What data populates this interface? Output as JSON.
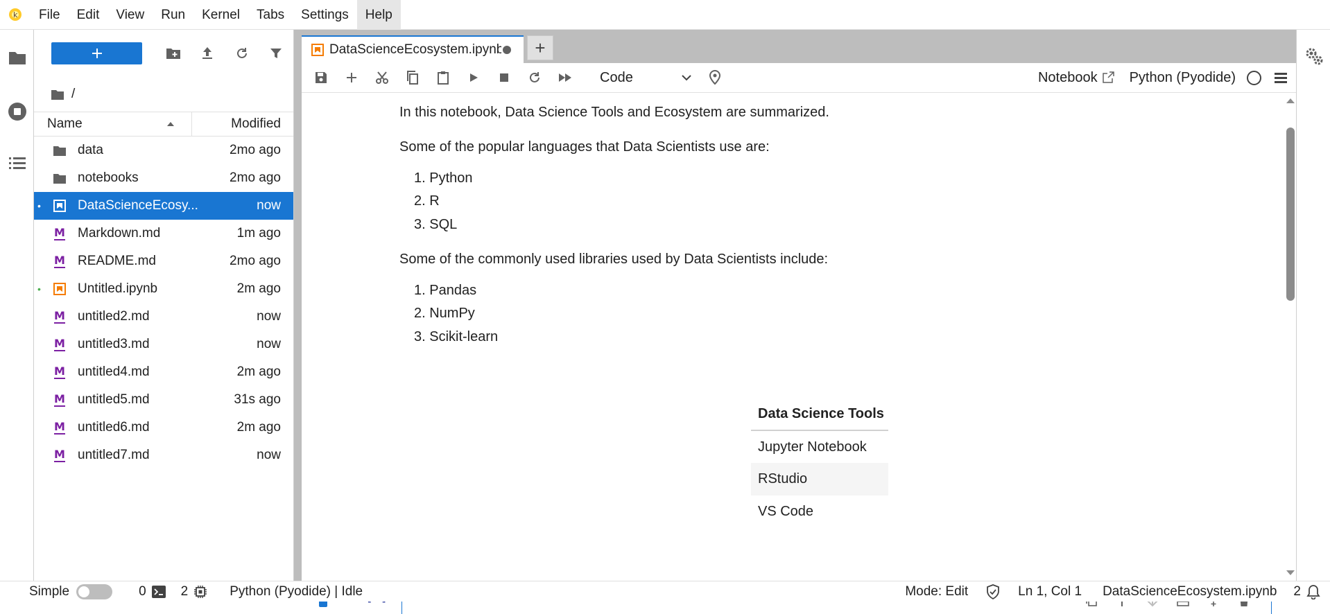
{
  "menu": {
    "items": [
      "File",
      "Edit",
      "View",
      "Run",
      "Kernel",
      "Tabs",
      "Settings",
      "Help"
    ],
    "active": "Help"
  },
  "filebrowser": {
    "breadcrumb": "/",
    "columns": {
      "name": "Name",
      "modified": "Modified"
    },
    "items": [
      {
        "name": "data",
        "modified": "2mo ago",
        "type": "folder",
        "dot": ""
      },
      {
        "name": "notebooks",
        "modified": "2mo ago",
        "type": "folder",
        "dot": ""
      },
      {
        "name": "DataScienceEcosy...",
        "modified": "now",
        "type": "notebook",
        "dot": "•",
        "selected": true
      },
      {
        "name": "Markdown.md",
        "modified": "1m ago",
        "type": "markdown",
        "dot": ""
      },
      {
        "name": "README.md",
        "modified": "2mo ago",
        "type": "markdown",
        "dot": ""
      },
      {
        "name": "Untitled.ipynb",
        "modified": "2m ago",
        "type": "notebook-orange",
        "dot": "•"
      },
      {
        "name": "untitled2.md",
        "modified": "now",
        "type": "markdown",
        "dot": ""
      },
      {
        "name": "untitled3.md",
        "modified": "now",
        "type": "markdown",
        "dot": ""
      },
      {
        "name": "untitled4.md",
        "modified": "2m ago",
        "type": "markdown",
        "dot": ""
      },
      {
        "name": "untitled5.md",
        "modified": "31s ago",
        "type": "markdown",
        "dot": ""
      },
      {
        "name": "untitled6.md",
        "modified": "2m ago",
        "type": "markdown",
        "dot": ""
      },
      {
        "name": "untitled7.md",
        "modified": "now",
        "type": "markdown",
        "dot": ""
      }
    ]
  },
  "tab": {
    "label": "DataScienceEcosystem.ipynb",
    "new_tab": "+"
  },
  "toolbar": {
    "cell_type": "Code",
    "notebook_label": "Notebook",
    "kernel_name": "Python (Pyodide)"
  },
  "notebook": {
    "intro": "In this notebook, Data Science Tools and Ecosystem are summarized.",
    "languages_heading": "Some of the popular languages that Data Scientists use are:",
    "languages": [
      "1. Python",
      "2. R",
      "3. SQL"
    ],
    "libraries_heading": "Some of the commonly used libraries used by Data Scientists include:",
    "libraries": [
      "1. Pandas",
      "2. NumPy",
      "3. Scikit-learn"
    ],
    "table": {
      "header": "Data Science Tools",
      "rows": [
        "Jupyter Notebook",
        "RStudio",
        "VS Code"
      ]
    },
    "prompt": "[ ]:"
  },
  "statusbar": {
    "simple_label": "Simple",
    "terminals": "0",
    "kernels": "2",
    "kernel_status": "Python (Pyodide) | Idle",
    "mode": "Mode: Edit",
    "cursor": "Ln 1, Col 1",
    "filename": "DataScienceEcosystem.ipynb",
    "notifications": "2"
  },
  "colors": {
    "accent": "#1976d2",
    "markdown_icon": "#7b1fa2",
    "notebook_icon": "#f57c00",
    "running_dot": "#4caf50"
  }
}
